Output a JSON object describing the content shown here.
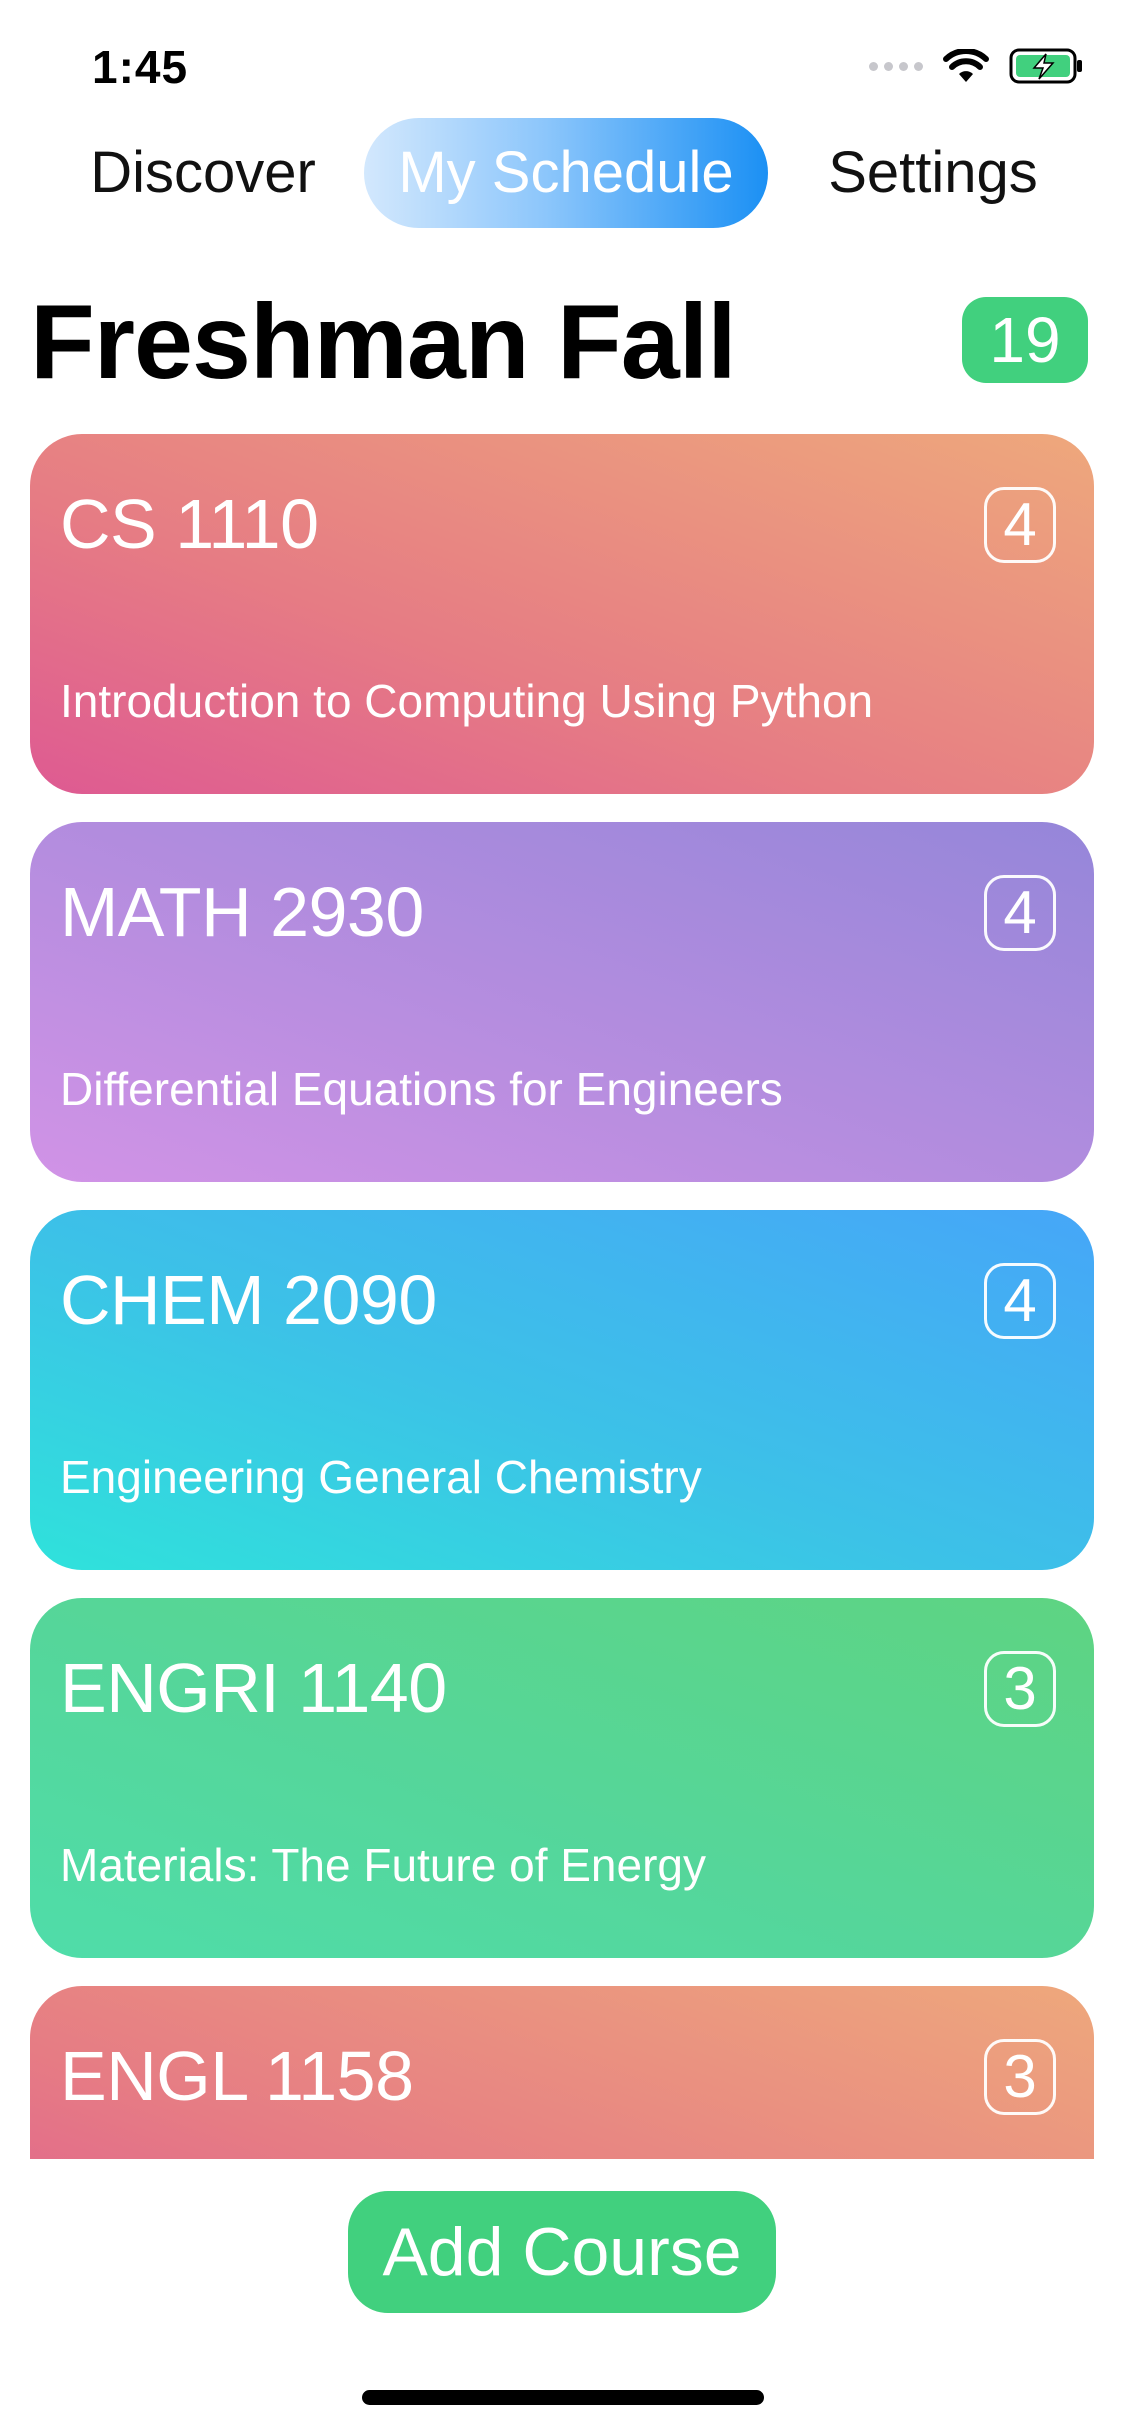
{
  "status_bar": {
    "time": "1:45",
    "icons": [
      "signal-dots-icon",
      "wifi-icon",
      "battery-charging-icon"
    ]
  },
  "nav": {
    "tabs": [
      {
        "label": "Discover",
        "selected": false
      },
      {
        "label": "My Schedule",
        "selected": true
      },
      {
        "label": "Settings",
        "selected": false
      }
    ]
  },
  "header": {
    "title": "Freshman Fall",
    "total_credits": "19"
  },
  "courses": [
    {
      "code": "CS 1110",
      "credits": "4",
      "title": "Introduction to Computing Using Python",
      "gradient": [
        "#de5a92",
        "#eea87c"
      ]
    },
    {
      "code": "MATH 2930",
      "credits": "4",
      "title": "Differential Equations for Engineers",
      "gradient": [
        "#d193e6",
        "#9586d9"
      ]
    },
    {
      "code": "CHEM 2090",
      "credits": "4",
      "title": "Engineering General Chemistry",
      "gradient": [
        "#2fe2db",
        "#46a6f8"
      ]
    },
    {
      "code": "ENGRI 1140",
      "credits": "3",
      "title": "Materials: The Future of Energy",
      "gradient": [
        "#4fdda9",
        "#5ed482"
      ]
    },
    {
      "code": "ENGL 1158",
      "credits": "3",
      "title": "",
      "gradient": [
        "#de5a92",
        "#eea87c"
      ]
    }
  ],
  "actions": {
    "add_course_label": "Add Course"
  },
  "colors": {
    "accent_green": "#41d07e",
    "tab_selected_blue": "#1b90f4"
  }
}
